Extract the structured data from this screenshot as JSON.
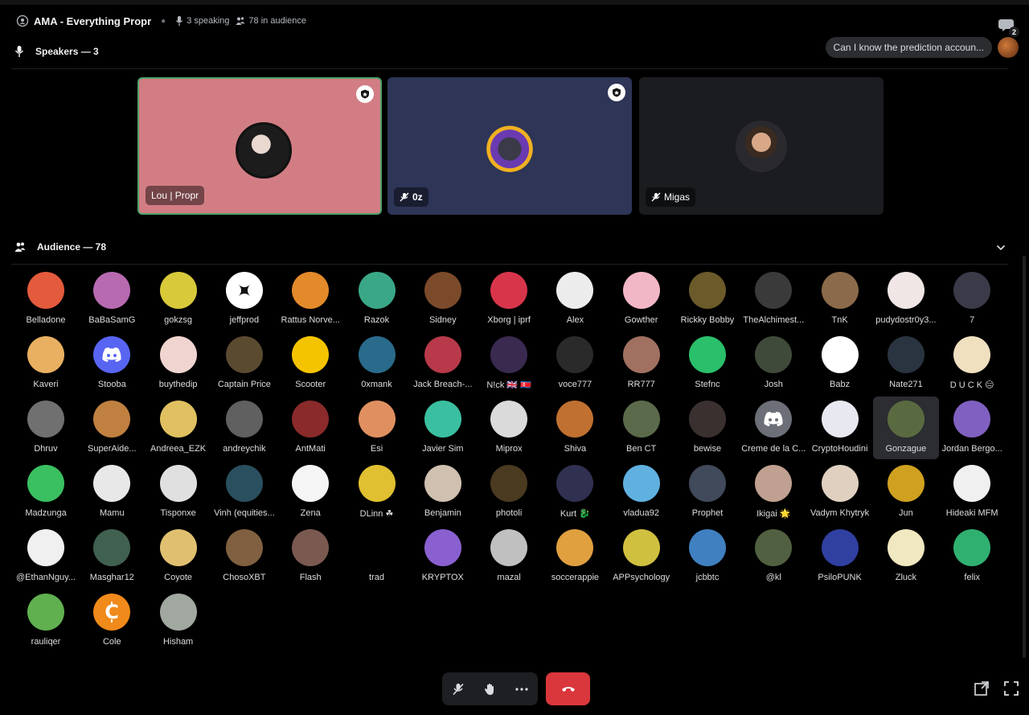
{
  "stage": {
    "title": "AMA - Everything Propr",
    "speaking": "3 speaking",
    "audience_count": "78 in audience",
    "chat_badge": "2"
  },
  "speakers_section": {
    "label": "Speakers — 3"
  },
  "audience_section": {
    "label": "Audience — 78"
  },
  "chat_preview": {
    "text": "Can I know the prediction accoun..."
  },
  "speakers": [
    {
      "name": "Lou | Propr",
      "bg": "#d27d84",
      "border": "#4fa36a",
      "muted": false,
      "moderator": true
    },
    {
      "name": "0z",
      "bg": "#2e3556",
      "border": "",
      "muted": true,
      "moderator": true
    },
    {
      "name": "Migas",
      "bg": "#1b1c1f",
      "border": "",
      "muted": true,
      "moderator": false
    }
  ],
  "audience": [
    {
      "name": "Belladone",
      "color": "#e45a3c"
    },
    {
      "name": "BaBaSamG",
      "color": "#b76ab0"
    },
    {
      "name": "gokzsg",
      "color": "#d8c93a"
    },
    {
      "name": "jeffprod",
      "color": "#ffffff",
      "icon": "x-logo-icon"
    },
    {
      "name": "Rattus Norve...",
      "color": "#e38a2a"
    },
    {
      "name": "Razok",
      "color": "#3aa887"
    },
    {
      "name": "Sidney",
      "color": "#7b4a2a"
    },
    {
      "name": "Xborg | iprf",
      "color": "#d8354a"
    },
    {
      "name": "Alex",
      "color": "#ececec"
    },
    {
      "name": "Gowther",
      "color": "#f2b7c6"
    },
    {
      "name": "Rickky Bobby",
      "color": "#6b5a2a"
    },
    {
      "name": "TheAlchimest...",
      "color": "#3a3a3a"
    },
    {
      "name": "TnK",
      "color": "#8a6a4a"
    },
    {
      "name": "pudydostr0y3...",
      "color": "#f0e6e6"
    },
    {
      "name": "7",
      "color": "#3a3a48"
    },
    {
      "name": "Kaveri",
      "color": "#e8b060"
    },
    {
      "name": "Stooba",
      "color": "#5865f2",
      "icon": "discord-icon"
    },
    {
      "name": "buythedip",
      "color": "#f0d4d0"
    },
    {
      "name": "Captain Price",
      "color": "#5a4a30"
    },
    {
      "name": "Scooter",
      "color": "#f5c400"
    },
    {
      "name": "0xmank",
      "color": "#2a6a8a"
    },
    {
      "name": "Jack Breach-...",
      "color": "#b83a4a"
    },
    {
      "name": "N!ck 🇬🇧 🇰🇵",
      "color": "#3a2a50"
    },
    {
      "name": "voce777",
      "color": "#2a2a2a"
    },
    {
      "name": "RR777",
      "color": "#a07060"
    },
    {
      "name": "Stefnc",
      "color": "#2abf6a"
    },
    {
      "name": "Josh",
      "color": "#404a3a"
    },
    {
      "name": "Babz",
      "color": "#ffffff"
    },
    {
      "name": "Nate271",
      "color": "#2a3440"
    },
    {
      "name": "D U C K 😑",
      "color": "#f0e0c0"
    },
    {
      "name": "Dhruv",
      "color": "#707070"
    },
    {
      "name": "SuperAide...",
      "color": "#c08040"
    },
    {
      "name": "Andreea_EZK",
      "color": "#e0c060"
    },
    {
      "name": "andreychik",
      "color": "#606060"
    },
    {
      "name": "AntMati",
      "color": "#8a2a2a"
    },
    {
      "name": "Esi",
      "color": "#e09060"
    },
    {
      "name": "Javier Sim",
      "color": "#3ac0a0"
    },
    {
      "name": "Miprox",
      "color": "#dadada"
    },
    {
      "name": "Shiva",
      "color": "#c07030"
    },
    {
      "name": "Ben CT",
      "color": "#5a6a4a"
    },
    {
      "name": "bewise",
      "color": "#3a3030"
    },
    {
      "name": "Creme de la C...",
      "color": "#6d6f78",
      "icon": "discord-icon"
    },
    {
      "name": "CryptoHoudini",
      "color": "#e8e8f0"
    },
    {
      "name": "Gonzague",
      "color": "#5a6a40"
    },
    {
      "name": "Jordan Bergo...",
      "color": "#8060c0"
    },
    {
      "name": "Madzunga",
      "color": "#3ac060"
    },
    {
      "name": "Mamu",
      "color": "#e8e8e8"
    },
    {
      "name": "Tisponxe",
      "color": "#e0e0e0"
    },
    {
      "name": "Vinh (equities...",
      "color": "#2a5060"
    },
    {
      "name": "Zena",
      "color": "#f5f5f5"
    },
    {
      "name": "DLinn ☘",
      "color": "#e0c030"
    },
    {
      "name": "Benjamin",
      "color": "#d0c0b0"
    },
    {
      "name": "photoli",
      "color": "#4a3a20"
    },
    {
      "name": "Kurt 🐉",
      "color": "#303050"
    },
    {
      "name": "vladua92",
      "color": "#60b0e0"
    },
    {
      "name": "Prophet",
      "color": "#404a5a"
    },
    {
      "name": "Ikigai 🌟",
      "color": "#c0a090"
    },
    {
      "name": "Vadym Khytryk",
      "color": "#e0d0c0"
    },
    {
      "name": "Jun",
      "color": "#d0a020"
    },
    {
      "name": "Hideaki MFM",
      "color": "#f0f0f0"
    },
    {
      "name": "@EthanNguy...",
      "color": "#f0f0f0"
    },
    {
      "name": "Masghar12",
      "color": "#406050"
    },
    {
      "name": "Coyote",
      "color": "#e0c070"
    },
    {
      "name": "ChosoXBT",
      "color": "#806040"
    },
    {
      "name": "Flash",
      "color": "#7a5a50"
    },
    {
      "name": "trad",
      "color": "#000000"
    },
    {
      "name": "KRYPTOX",
      "color": "#8a60d0"
    },
    {
      "name": "mazal",
      "color": "#c0c0c0"
    },
    {
      "name": "soccerappie",
      "color": "#e0a040"
    },
    {
      "name": "APPsychology",
      "color": "#d0c040"
    },
    {
      "name": "jcbbtc",
      "color": "#4080c0"
    },
    {
      "name": "@kl",
      "color": "#506040"
    },
    {
      "name": "PsiloPUNK",
      "color": "#3040a0"
    },
    {
      "name": "Zluck",
      "color": "#f0e8c0"
    },
    {
      "name": "felix",
      "color": "#30b070"
    },
    {
      "name": "rauliqer",
      "color": "#60b050"
    },
    {
      "name": "Cole",
      "color": "#f08a1a",
      "icon": "coin-c-icon"
    },
    {
      "name": "Hisham",
      "color": "#a0a8a0"
    }
  ]
}
